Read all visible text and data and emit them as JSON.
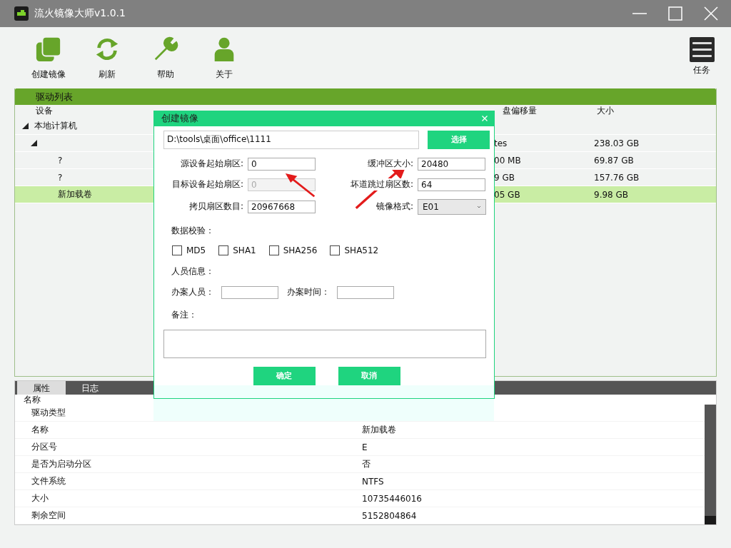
{
  "window": {
    "title": "流火镜像大师v1.0.1"
  },
  "toolbar": [
    {
      "label": "创建镜像",
      "kind": "copy"
    },
    {
      "label": "刷新",
      "kind": "refresh"
    },
    {
      "label": "帮助",
      "kind": "wrench"
    },
    {
      "label": "关于",
      "kind": "user"
    }
  ],
  "task_button": {
    "label": "任务"
  },
  "drive_list": {
    "title": "驱动列表",
    "columns": [
      {
        "label": "设备"
      },
      {
        "label": "盘偏移量"
      },
      {
        "label": "大小"
      }
    ],
    "rows": [
      {
        "name": "本地计算机",
        "expanded": true,
        "selected": false,
        "children": [
          {
            "expanded": true,
            "selected": false,
            "offset": "tes",
            "size": "238.03 GB",
            "children": [
              {
                "name": "?",
                "selected": false,
                "offset": "00 MB",
                "size": "69.87 GB"
              },
              {
                "name": "?",
                "selected": false,
                "offset": "9 GB",
                "size": "157.76 GB"
              },
              {
                "name": "新加载卷",
                "selected": true,
                "offset": "05 GB",
                "size": "9.98 GB"
              }
            ]
          }
        ]
      }
    ]
  },
  "bottom_tabs": [
    {
      "label": "属性",
      "selected": true
    },
    {
      "label": "日志",
      "selected": false
    }
  ],
  "properties": {
    "header": "名称",
    "rows": [
      {
        "name": "驱动类型"
      },
      {
        "name": "名称",
        "value": "新加载卷"
      },
      {
        "name": "分区号",
        "value": "E"
      },
      {
        "name": "是否为启动分区",
        "value": "否"
      },
      {
        "name": "文件系统",
        "value": "NTFS"
      },
      {
        "name": "大小",
        "value": "10735446016"
      },
      {
        "name": "剩余空间",
        "value": "5152804864"
      }
    ]
  },
  "dialog": {
    "title": "创建镜像",
    "path": "D:\\tools\\桌面\\office\\1111",
    "browse_button": "选择",
    "fields": [
      {
        "label": "源设备起始扇区:",
        "value": "0",
        "kind": "text",
        "disabled": false
      },
      {
        "label": "缓冲区大小:",
        "value": "20480",
        "kind": "text",
        "disabled": false
      },
      {
        "label": "目标设备起始扇区:",
        "value": "0",
        "kind": "text",
        "disabled": true
      },
      {
        "label": "坏道跳过扇区数:",
        "value": "64",
        "kind": "text",
        "disabled": false
      },
      {
        "label": "拷贝扇区数目:",
        "value": "20967668",
        "kind": "text",
        "disabled": false
      },
      {
        "label": "镜像格式:",
        "value": "E01",
        "kind": "select",
        "disabled": false
      }
    ],
    "verify_label": "数据校验：",
    "checksums": [
      {
        "label": "MD5",
        "checked": false
      },
      {
        "label": "SHA1",
        "checked": false
      },
      {
        "label": "SHA256",
        "checked": false
      },
      {
        "label": "SHA512",
        "checked": false
      }
    ],
    "person_label": "人员信息：",
    "person_fields": [
      {
        "label": "办案人员："
      },
      {
        "label": "办案时间："
      }
    ],
    "notes_label": "备注：",
    "buttons": [
      "确定",
      "取消"
    ]
  }
}
